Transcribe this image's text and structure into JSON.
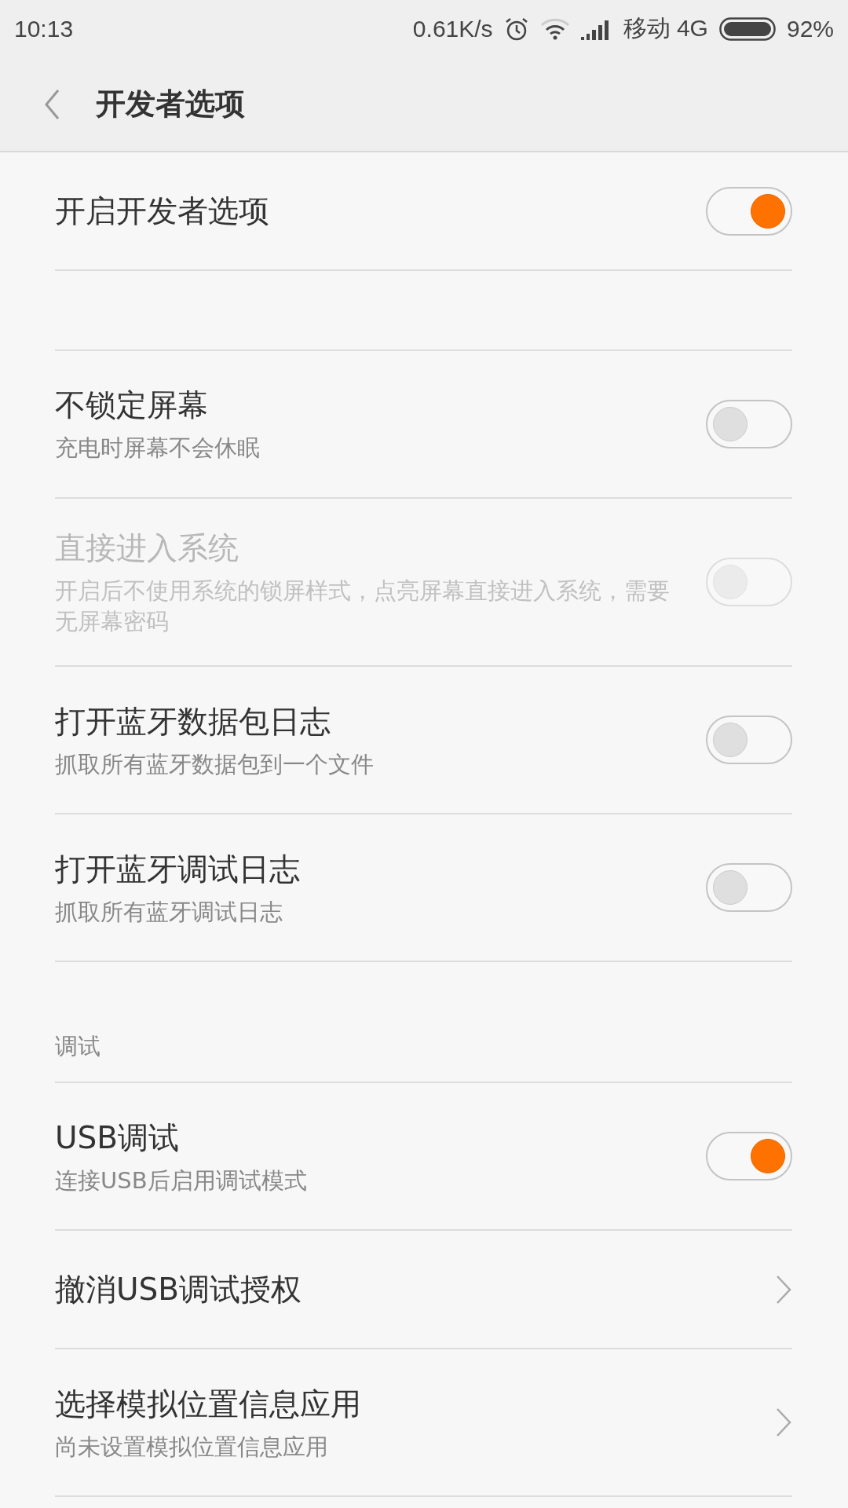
{
  "status_bar": {
    "time": "10:13",
    "speed": "0.61K/s",
    "carrier": "移动 4G",
    "battery": "92%"
  },
  "header": {
    "title": "开发者选项"
  },
  "sections": [
    {
      "items": [
        {
          "kind": "toggle",
          "title": "开启开发者选项",
          "on": true,
          "disabled": false
        }
      ]
    },
    {
      "items": [
        {
          "kind": "toggle",
          "title": "不锁定屏幕",
          "summary": "充电时屏幕不会休眠",
          "on": false,
          "disabled": false
        },
        {
          "kind": "toggle",
          "title": "直接进入系统",
          "summary": "开启后不使用系统的锁屏样式，点亮屏幕直接进入系统，需要无屏幕密码",
          "on": false,
          "disabled": true
        },
        {
          "kind": "toggle",
          "title": "打开蓝牙数据包日志",
          "summary": "抓取所有蓝牙数据包到一个文件",
          "on": false,
          "disabled": false
        },
        {
          "kind": "toggle",
          "title": "打开蓝牙调试日志",
          "summary": "抓取所有蓝牙调试日志",
          "on": false,
          "disabled": false
        }
      ]
    },
    {
      "header": "调试",
      "items": [
        {
          "kind": "toggle",
          "title": "USB调试",
          "summary": "连接USB后启用调试模式",
          "on": true,
          "disabled": false
        },
        {
          "kind": "link",
          "title": "撤消USB调试授权"
        },
        {
          "kind": "link",
          "title": "选择模拟位置信息应用",
          "summary": "尚未设置模拟位置信息应用"
        }
      ]
    }
  ]
}
